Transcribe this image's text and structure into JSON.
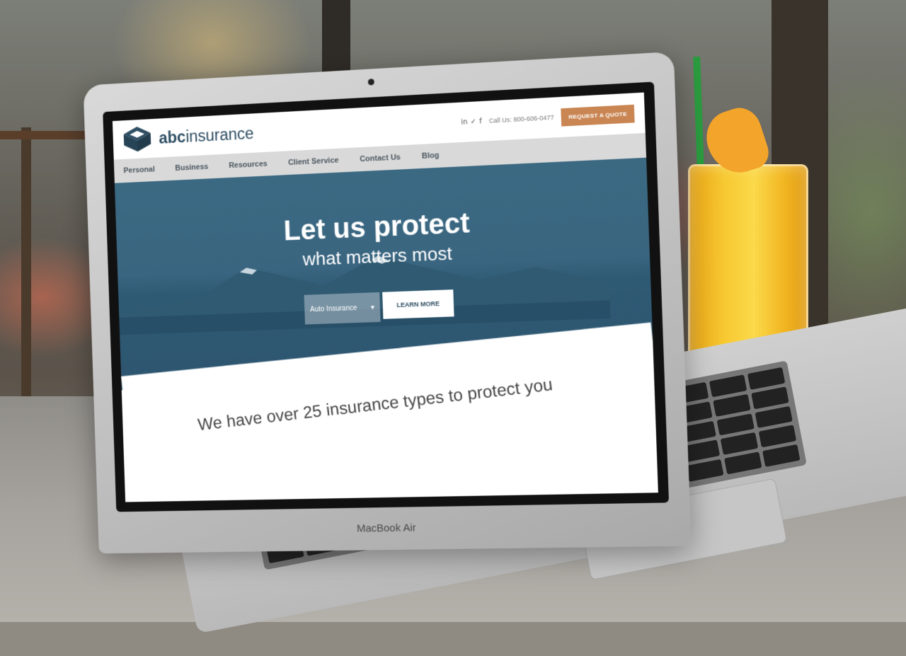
{
  "site": {
    "logo": {
      "bold": "abc",
      "rest": "insurance"
    },
    "social_icons": [
      "linkedin-icon",
      "twitter-icon",
      "facebook-icon"
    ],
    "social_glyphs": [
      "in",
      "✓",
      "f"
    ],
    "phone": "Call Us: 800-606-0477",
    "quote_button": "REQUEST A QUOTE",
    "nav": [
      "Personal",
      "Business",
      "Resources",
      "Client Service",
      "Contact Us",
      "Blog"
    ],
    "hero": {
      "title": "Let us protect",
      "subtitle": "what matters most",
      "select_value": "Auto Insurance",
      "select_arrow": "▾",
      "learn_more": "LEARN MORE"
    },
    "types_heading": "We have over 25 insurance types to protect you"
  },
  "device": {
    "brand": "MacBook Air"
  },
  "colors": {
    "accent": "#c98552",
    "brand_navy": "#2d4d63",
    "hero_blue": "#3a6580",
    "nav_gray": "#d9d9d9"
  }
}
